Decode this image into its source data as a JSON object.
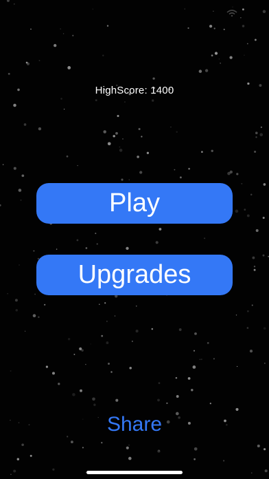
{
  "colors": {
    "background": "#020202",
    "button_fill": "#3478f6",
    "button_text": "#ffffff",
    "share_text": "#3478f6",
    "highscore_text": "#ffffff",
    "star": "#ffffff"
  },
  "status_bar": {
    "icon": "wifi-icon"
  },
  "highscore": {
    "text": "HighScore: 1400"
  },
  "menu": {
    "play_label": "Play",
    "upgrades_label": "Upgrades",
    "share_label": "Share"
  },
  "background": {
    "type": "starfield"
  }
}
